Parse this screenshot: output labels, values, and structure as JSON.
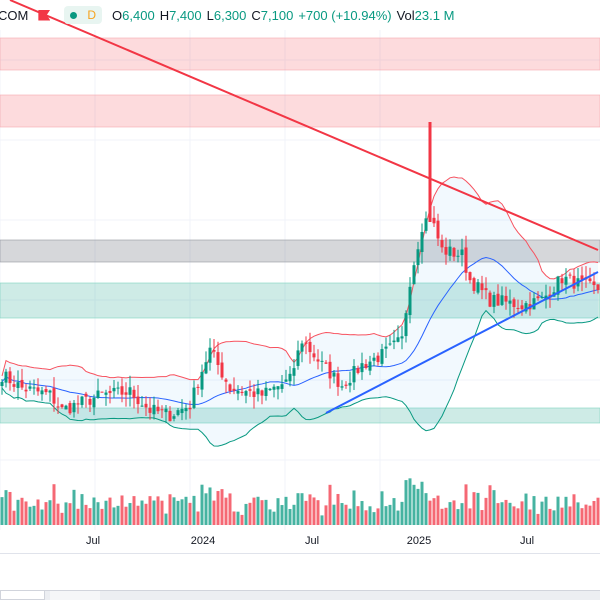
{
  "header": {
    "symbol": "COM",
    "interval": "D",
    "open_label": "O",
    "open": "6,400",
    "high_label": "H",
    "high": "7,400",
    "low_label": "L",
    "low": "6,300",
    "close_label": "C",
    "close": "7,100",
    "change": "+700 (+10.94%)",
    "vol_label": "Vol",
    "volume": "23.1 M"
  },
  "colors": {
    "up": "#089981",
    "down": "#f23645",
    "upper_band": "#f7525f",
    "basis": "#2962ff",
    "lower_band": "#089981",
    "trend_down": "#f23645",
    "trend_up": "#2962ff"
  },
  "chart_data": {
    "type": "candlestick",
    "x_tick_labels": [
      "Jul",
      "2024",
      "Jul",
      "2025",
      "Jul"
    ],
    "candle_count": 150,
    "close_path": [
      [
        0,
        4975
      ],
      [
        5,
        4650
      ],
      [
        12,
        4475
      ],
      [
        15,
        4100
      ],
      [
        25,
        4475
      ],
      [
        32,
        4550
      ],
      [
        37,
        4100
      ],
      [
        42,
        3975
      ],
      [
        47,
        4225
      ],
      [
        50,
        5100
      ],
      [
        52,
        5600
      ],
      [
        57,
        4650
      ],
      [
        65,
        4475
      ],
      [
        72,
        4850
      ],
      [
        75,
        5850
      ],
      [
        80,
        5225
      ],
      [
        85,
        4725
      ],
      [
        90,
        5225
      ],
      [
        95,
        5475
      ],
      [
        100,
        5850
      ],
      [
        102,
        7350
      ],
      [
        105,
        8725
      ],
      [
        107,
        8975
      ],
      [
        110,
        8100
      ],
      [
        115,
        7975
      ],
      [
        117,
        7350
      ],
      [
        122,
        6850
      ],
      [
        130,
        6725
      ],
      [
        135,
        6850
      ],
      [
        140,
        7400
      ],
      [
        145,
        7225
      ],
      [
        149,
        7100
      ]
    ],
    "zones": [
      {
        "type": "resistance",
        "from": 12600,
        "to": 13400
      },
      {
        "type": "resistance",
        "from": 11175,
        "to": 11975
      },
      {
        "type": "neutral",
        "from": 7800,
        "to": 8350
      },
      {
        "type": "support",
        "from": 6400,
        "to": 7275
      },
      {
        "type": "support",
        "from": 3775,
        "to": 4150
      }
    ],
    "trendlines": [
      {
        "type": "down",
        "from": [
          2,
          14350
        ],
        "to": [
          149,
          8100
        ]
      },
      {
        "type": "up",
        "from": [
          81,
          4025
        ],
        "to": [
          149,
          7550
        ]
      }
    ],
    "bollinger_period": 20
  }
}
